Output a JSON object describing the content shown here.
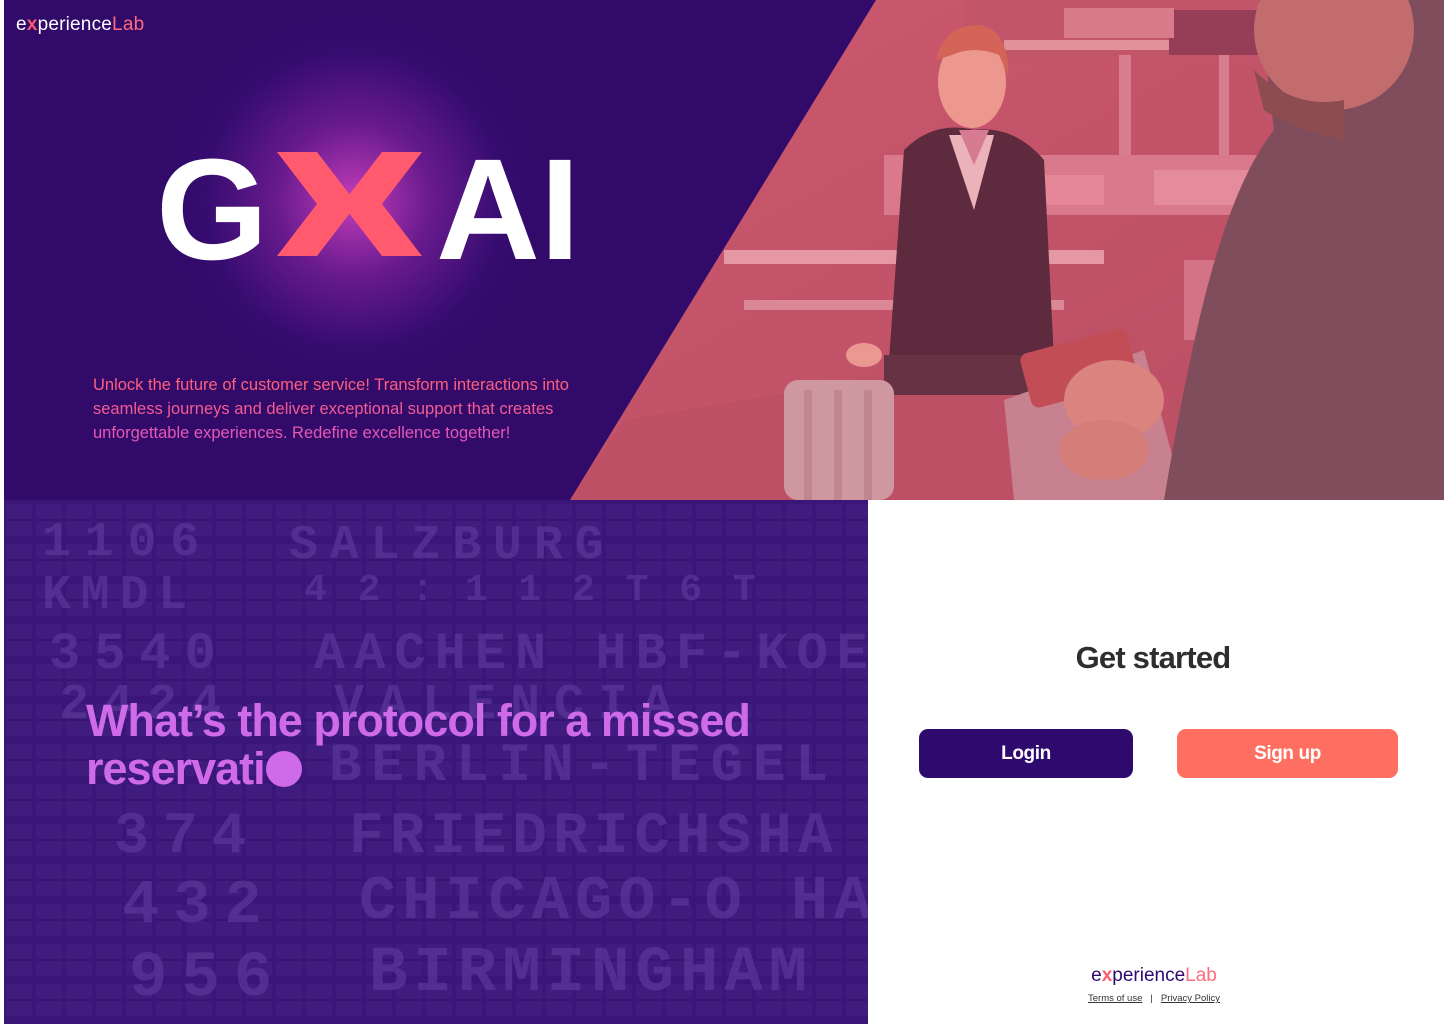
{
  "brand": {
    "name_e": "e",
    "name_x": "x",
    "name_rest": "perience",
    "name_lab": "Lab"
  },
  "hero": {
    "logo_left": "G",
    "logo_right": "AI",
    "tagline_lines": [
      "Unlock the future of customer service! Transform interactions into",
      "seamless journeys and deliver exceptional support that creates",
      "unforgettable experiences. Redefine excellence together!"
    ]
  },
  "board": {
    "question_line1": "What’s the protocol for a missed",
    "question_line2": "reservati",
    "rows": [
      {
        "num": "1106",
        "dest": "SALZBURG"
      },
      {
        "num": "KMDL",
        "dest": "4 2 : 1 1 2 T 6 T"
      },
      {
        "num": "3540",
        "dest": "AACHEN HBF-KOE"
      },
      {
        "num": "2424",
        "dest": "VALENCIA"
      },
      {
        "num": "",
        "dest": "BERLIN-TEGEL"
      },
      {
        "num": "374",
        "dest": "FRIEDRICHSHA"
      },
      {
        "num": "432",
        "dest": "CHICAGO-O HA"
      },
      {
        "num": "956",
        "dest": "BIRMINGHAM"
      }
    ]
  },
  "panel": {
    "heading": "Get started",
    "login_label": "Login",
    "signup_label": "Sign up",
    "terms_label": "Terms of use",
    "separator": "|",
    "privacy_label": "Privacy Policy"
  },
  "colors": {
    "primary": "#310a6a",
    "accent": "#ff6f61",
    "highlight": "#cf6be8",
    "brand_red": "#ff5a6e"
  }
}
